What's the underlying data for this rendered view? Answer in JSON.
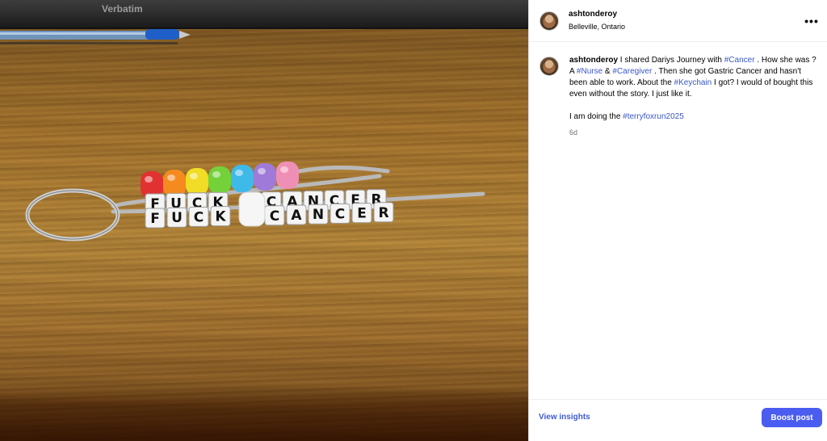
{
  "post": {
    "username": "ashtonderoy",
    "location": "Belleville, Ontario",
    "more_label": "•••"
  },
  "photo": {
    "laptop_brand": "Verbatim",
    "beads_line_1": [
      "F",
      "U",
      "C",
      "K",
      "C",
      "A",
      "N",
      "C",
      "E",
      "R"
    ],
    "beads_line_2": [
      "F",
      "U",
      "C",
      "K",
      "C",
      "A",
      "N",
      "C",
      "E",
      "R"
    ],
    "bead_colors": [
      "#e23131",
      "#f58a1f",
      "#f1dc26",
      "#74d13a",
      "#3fb9e8",
      "#9f7ad9",
      "#f08fb5"
    ]
  },
  "caption": {
    "username": "ashtonderoy",
    "t1": " I shared Dariys Journey with ",
    "tag1": "#Cancer",
    "t2": " . How she was ? A ",
    "tag2": "#Nurse",
    "t3": " & ",
    "tag3": "#Caregiver",
    "t4": " . Then she got Gastric Cancer and hasn't been able to work. About the ",
    "tag4": "#Keychain",
    "t5": " I got? I would of bought this even without the story. I just like it.",
    "p2_text": "I am doing the ",
    "p2_tag": "#terryfoxrun2025",
    "time": "6d"
  },
  "footer": {
    "insights_label": "View insights",
    "boost_label": "Boost post"
  },
  "colors": {
    "accent": "#4a5df0",
    "hashtag": "#3a58c8"
  }
}
